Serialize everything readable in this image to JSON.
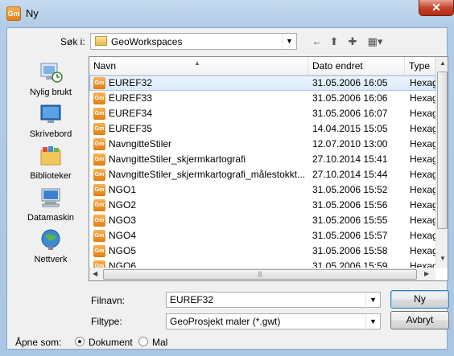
{
  "window": {
    "title": "Ny",
    "close_glyph": "✕"
  },
  "lookin": {
    "label": "Søk i:",
    "value": "GeoWorkspaces"
  },
  "toolbar": {
    "back_glyph": "←",
    "up_glyph": "⬆",
    "new_folder_glyph": "✚",
    "view_glyph": "▦▾"
  },
  "places": [
    {
      "label": "Nylig brukt",
      "icon": "recent-places-icon"
    },
    {
      "label": "Skrivebord",
      "icon": "desktop-icon"
    },
    {
      "label": "Biblioteker",
      "icon": "libraries-icon"
    },
    {
      "label": "Datamaskin",
      "icon": "computer-icon"
    },
    {
      "label": "Nettverk",
      "icon": "network-icon"
    }
  ],
  "columns": {
    "name": "Navn",
    "date": "Dato endret",
    "type": "Type"
  },
  "files": [
    {
      "name": "EUREF32",
      "date": "31.05.2006 16:05",
      "type": "Hexagon"
    },
    {
      "name": "EUREF33",
      "date": "31.05.2006 16:06",
      "type": "Hexagon"
    },
    {
      "name": "EUREF34",
      "date": "31.05.2006 16:07",
      "type": "Hexagon"
    },
    {
      "name": "EUREF35",
      "date": "14.04.2015 15:05",
      "type": "Hexagon"
    },
    {
      "name": "NavngitteStiler",
      "date": "12.07.2010 13:00",
      "type": "Hexagon"
    },
    {
      "name": "NavngitteStiler_skjermkartografi",
      "date": "27.10.2014 15:41",
      "type": "Hexagon"
    },
    {
      "name": "NavngitteStiler_skjermkartografi_målestokkt...",
      "date": "27.10.2014 15:44",
      "type": "Hexagon"
    },
    {
      "name": "NGO1",
      "date": "31.05.2006 15:52",
      "type": "Hexagon"
    },
    {
      "name": "NGO2",
      "date": "31.05.2006 15:56",
      "type": "Hexagon"
    },
    {
      "name": "NGO3",
      "date": "31.05.2006 15:55",
      "type": "Hexagon"
    },
    {
      "name": "NGO4",
      "date": "31.05.2006 15:57",
      "type": "Hexagon"
    },
    {
      "name": "NGO5",
      "date": "31.05.2006 15:58",
      "type": "Hexagon"
    },
    {
      "name": "NGO6",
      "date": "31.05.2006 15:59",
      "type": "Hexagon"
    }
  ],
  "filename": {
    "label": "Filnavn:",
    "value": "EUREF32"
  },
  "filetype": {
    "label": "Filtype:",
    "value": "GeoProsjekt maler (*.gwt)"
  },
  "buttons": {
    "ok": "Ny",
    "cancel": "Avbryt"
  },
  "openas": {
    "label": "Åpne som:",
    "option1": "Dokument",
    "option2": "Mal",
    "selected": "Dokument"
  }
}
